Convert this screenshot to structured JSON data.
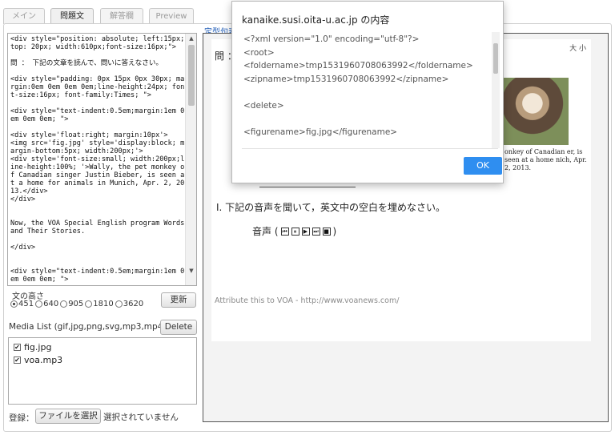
{
  "tabs": [
    {
      "label": "メイン",
      "active": false
    },
    {
      "label": "問題文",
      "active": true
    },
    {
      "label": "解答欄",
      "active": false
    },
    {
      "label": "Preview",
      "active": false
    }
  ],
  "editor": {
    "source": "<div style=\"position: absolute; left:15px; top: 20px; width:610px;font-size:16px;\">\n\n問 ： 下記の文章を読んで、問いに答えなさい。\n\n<div style=\"padding: 0px 15px 0px 30px; margin:0em 0em 0em 0em;line-height:24px; font-size:16px; font-family:Times; \">\n\n<div style=\"text-indent:0.5em;margin:1em 0em 0em 0em; \">\n\n<div style='float:right; margin:10px'>\n<img src='fig.jpg' style='display:block; margin-bottom:5px; width:200px;'>\n<div style='font-size:small; width:200px;line-height:100%; '>Wally, the pet monkey of Canadian singer Justin Bieber, is seen at a home for animals in Munich, Apr. 2, 2013.</div>\n</div>\n\n\nNow, the VOA Special English program Words and Their Stories.\n\n</div>\n\n\n<div style=\"text-indent:0.5em;margin:1em 0em 0em 0em; \">"
  },
  "height_section": {
    "label": "文の高さ",
    "options": [
      "451",
      "640",
      "905",
      "1810",
      "3620"
    ],
    "selected": "451",
    "update_button": "更新"
  },
  "media": {
    "label": "Media List (gif,jpg,png,svg,mp3,mp4)",
    "delete_button": "Delete",
    "files": [
      {
        "name": "fig.jpg",
        "checked": true
      },
      {
        "name": "voa.mp3",
        "checked": true
      }
    ]
  },
  "register": {
    "label": "登録：",
    "choose_button": "ファイルを選択",
    "status": "選択されていません"
  },
  "preview": {
    "link": "定型句表",
    "size_controls": "大 小",
    "question_head": "問 ：",
    "caption": "onkey of Canadian er, is seen at a home nich, Apr. 2, 2013.",
    "q1": "I. 下記の音声を聞いて，英文中の空白を埋めなさい。",
    "audio_label": "音声 (",
    "audio_end": ")",
    "attribution": "Attribute this to VOA - http://www.voanews.com/"
  },
  "dialog": {
    "title": "kanaike.susi.oita-u.ac.jp の内容",
    "content": "<?xml version=\"1.0\" encoding=\"utf-8\"?>\n<root>\n<foldername>tmp1531960708063992</foldername>\n<zipname>tmp1531960708063992</zipname>\n\n<delete>\n\n<figurename>fig.jpg</figurename>",
    "ok_button": "OK"
  },
  "colors": {
    "accent": "#2f8ef0",
    "link": "#1a58b5"
  }
}
